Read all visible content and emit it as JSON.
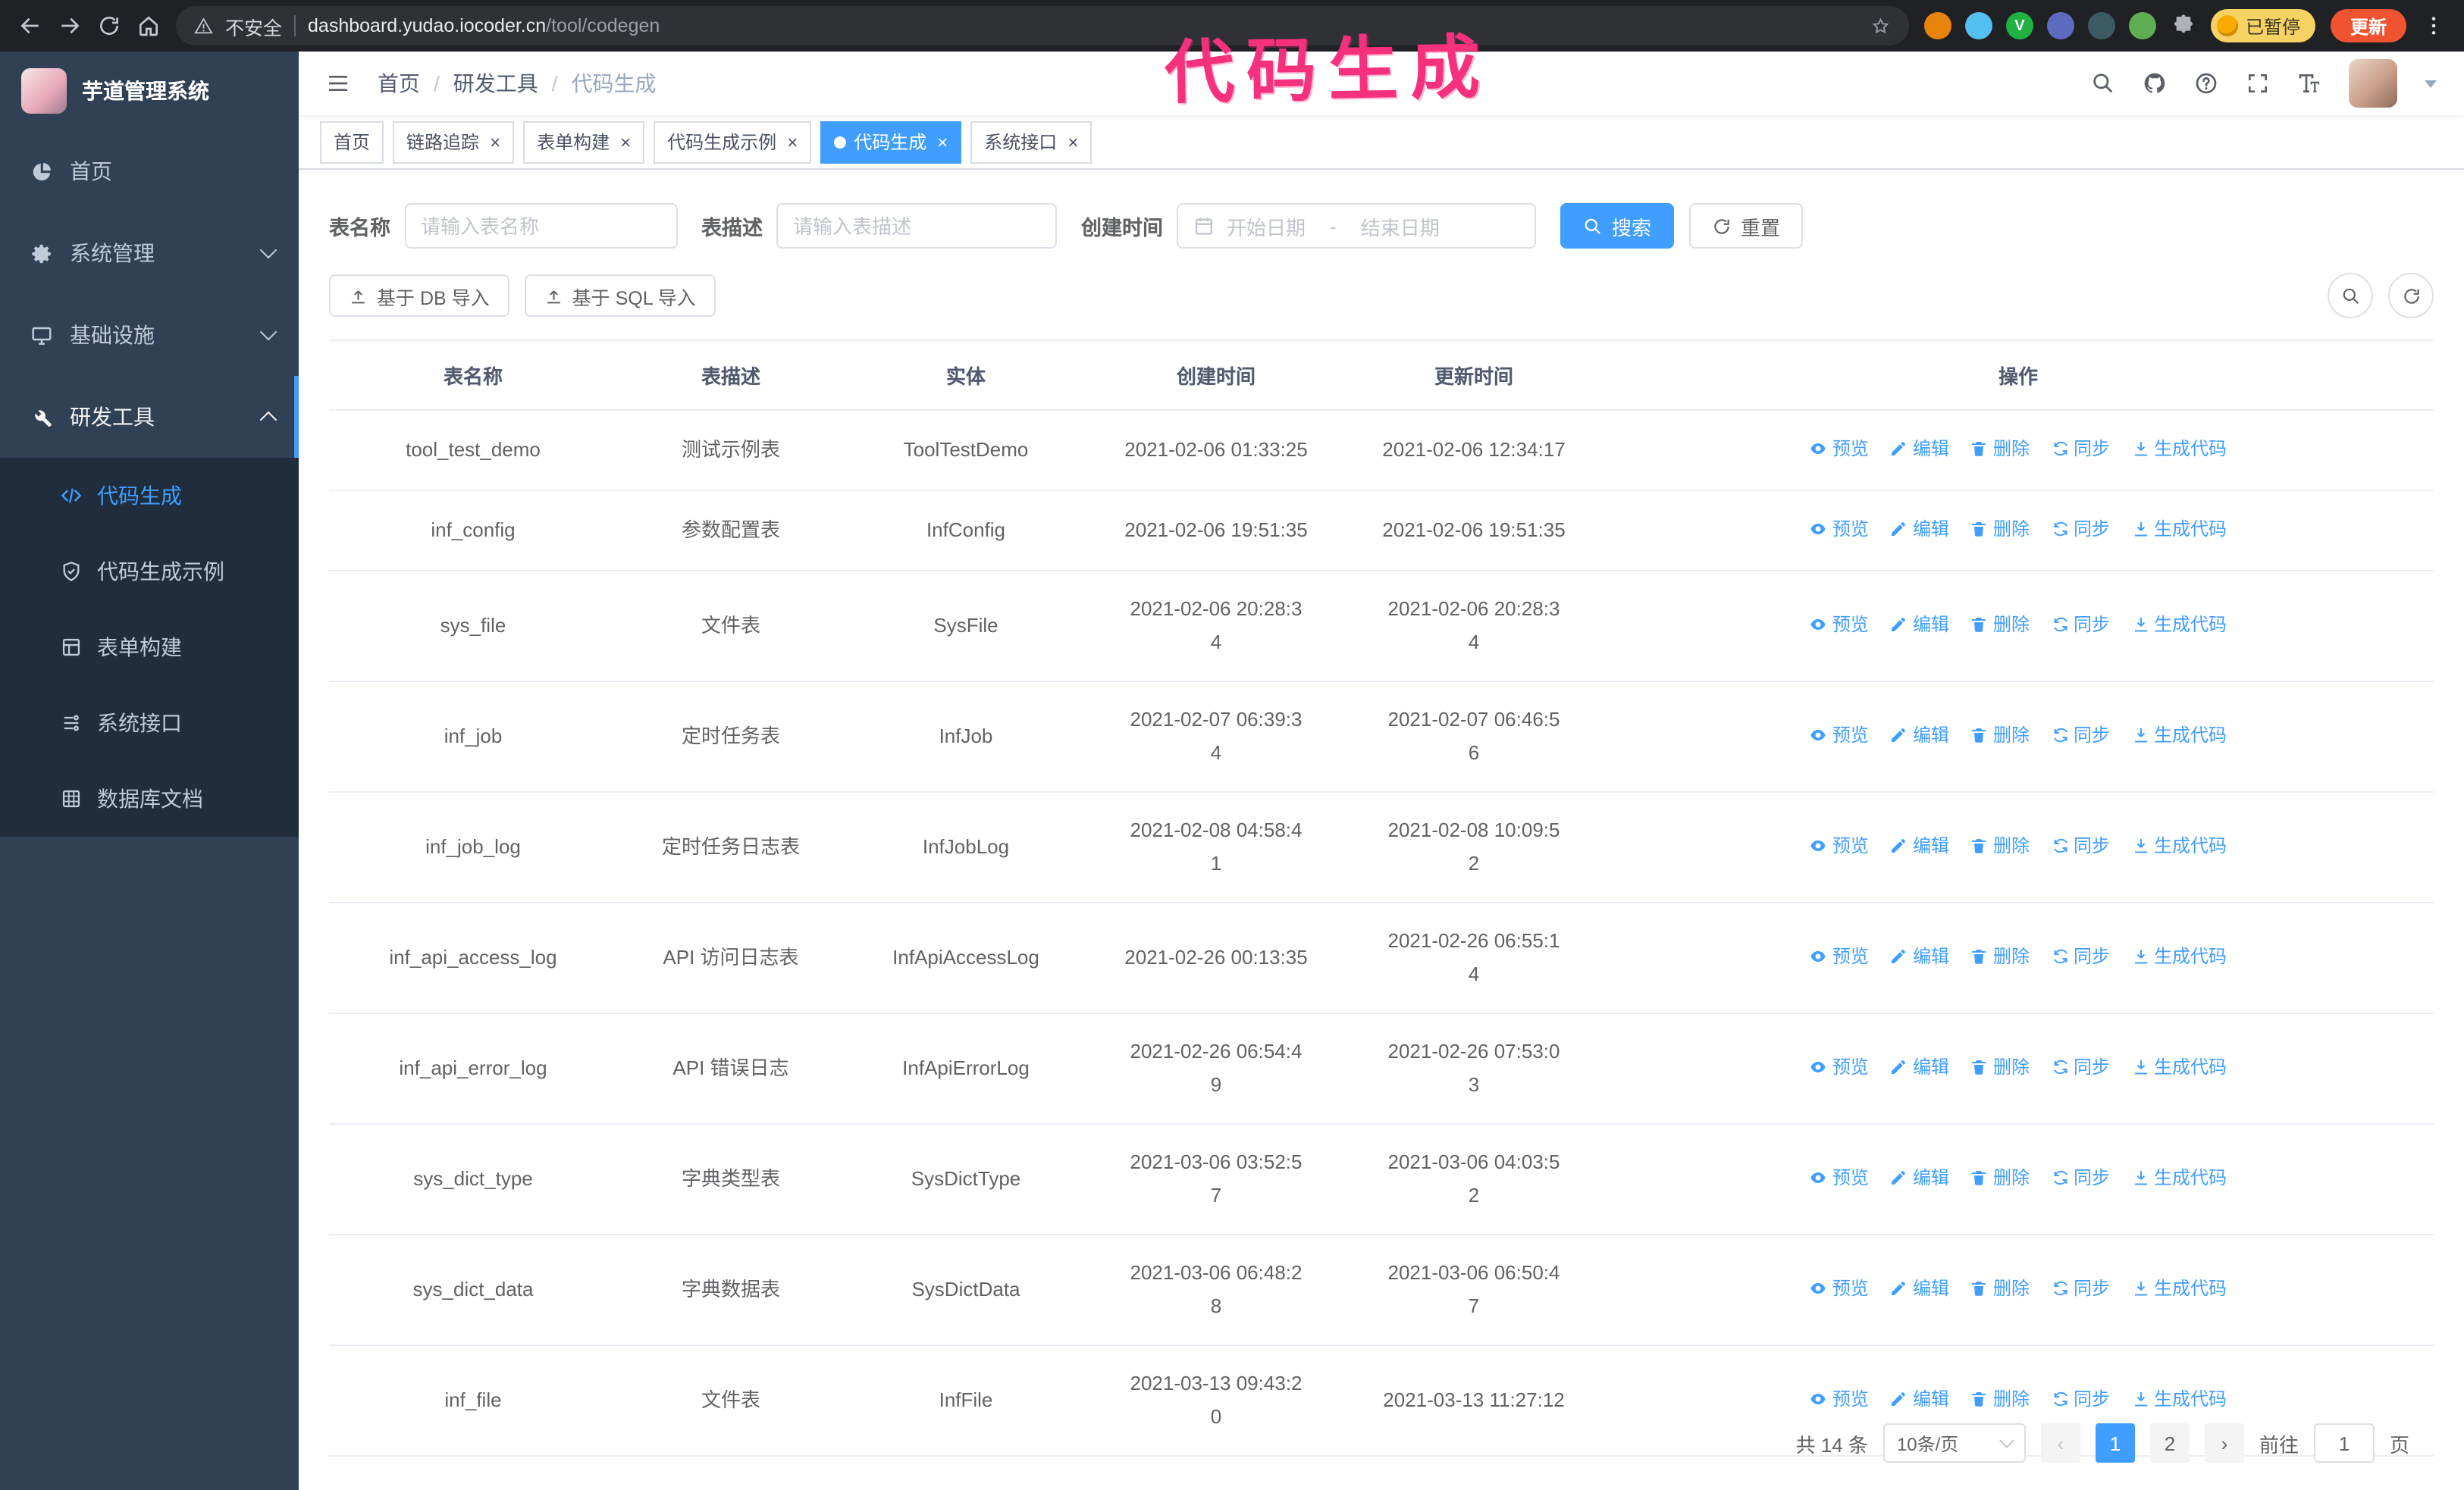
{
  "theme": {
    "accent": "#409eff",
    "sidebar_bg": "#304156",
    "submenu_bg": "#1f2d3d",
    "annotation_color": "#f5307d"
  },
  "annotation": {
    "text": "代码生成"
  },
  "browser": {
    "security_label": "不安全",
    "url_host": "dashboard.yudao.iocoder.cn",
    "url_path": "/tool/codegen",
    "extensions": [
      {
        "name": "orange-extension-icon",
        "color": "#e8830c"
      },
      {
        "name": "blue-extension-icon",
        "color": "#54c0f0"
      },
      {
        "name": "green-check-extension-icon",
        "color": "#1fb141",
        "glyph": "V"
      },
      {
        "name": "indigo-extension-icon",
        "color": "#5c6bc0"
      },
      {
        "name": "dark-extension-icon",
        "color": "#3c5a64"
      },
      {
        "name": "leaf-extension-icon",
        "color": "#5fae53"
      }
    ],
    "paused_badge": "已暂停",
    "update_button": "更新"
  },
  "sidebar": {
    "logo_title": "芋道管理系统",
    "items": [
      {
        "key": "home",
        "icon": "i-dash",
        "label": "首页"
      },
      {
        "key": "system",
        "icon": "i-gear",
        "label": "系统管理",
        "children_collapsed": true
      },
      {
        "key": "infra",
        "icon": "i-infra",
        "label": "基础设施",
        "children_collapsed": true
      },
      {
        "key": "devtools",
        "icon": "i-tool",
        "label": "研发工具",
        "open": true,
        "children": [
          {
            "key": "codegen",
            "icon": "i-code",
            "label": "代码生成",
            "active": true
          },
          {
            "key": "codegen-example",
            "icon": "i-badge",
            "label": "代码生成示例"
          },
          {
            "key": "form-build",
            "icon": "i-form",
            "label": "表单构建"
          },
          {
            "key": "system-api",
            "icon": "i-api",
            "label": "系统接口"
          },
          {
            "key": "db-doc",
            "icon": "i-db",
            "label": "数据库文档"
          }
        ]
      }
    ]
  },
  "header": {
    "breadcrumb": [
      "首页",
      "研发工具",
      "代码生成"
    ]
  },
  "tabs": [
    {
      "label": "首页",
      "closable": false
    },
    {
      "label": "链路追踪",
      "closable": true
    },
    {
      "label": "表单构建",
      "closable": true
    },
    {
      "label": "代码生成示例",
      "closable": true
    },
    {
      "label": "代码生成",
      "closable": true,
      "active": true
    },
    {
      "label": "系统接口",
      "closable": true
    }
  ],
  "filters": {
    "table_name_label": "表名称",
    "table_name_placeholder": "请输入表名称",
    "table_desc_label": "表描述",
    "table_desc_placeholder": "请输入表描述",
    "create_time_label": "创建时间",
    "start_date_placeholder": "开始日期",
    "range_separator": "-",
    "end_date_placeholder": "结束日期",
    "search_button": "搜索",
    "reset_button": "重置"
  },
  "toolbar": {
    "import_db_button": "基于 DB 导入",
    "import_sql_button": "基于 SQL 导入"
  },
  "table": {
    "columns": [
      "表名称",
      "表描述",
      "实体",
      "创建时间",
      "更新时间",
      "操作"
    ],
    "action_labels": [
      "预览",
      "编辑",
      "删除",
      "同步",
      "生成代码"
    ],
    "rows": [
      {
        "name": "tool_test_demo",
        "description": "测试示例表",
        "entity": "ToolTestDemo",
        "created": "2021-02-06 01:33:25",
        "updated": "2021-02-06 12:34:17"
      },
      {
        "name": "inf_config",
        "description": "参数配置表",
        "entity": "InfConfig",
        "created": "2021-02-06 19:51:35",
        "updated": "2021-02-06 19:51:35"
      },
      {
        "name": "sys_file",
        "description": "文件表",
        "entity": "SysFile",
        "created": "2021-02-06 20:28:3\n4",
        "updated": "2021-02-06 20:28:3\n4"
      },
      {
        "name": "inf_job",
        "description": "定时任务表",
        "entity": "InfJob",
        "created": "2021-02-07 06:39:3\n4",
        "updated": "2021-02-07 06:46:5\n6"
      },
      {
        "name": "inf_job_log",
        "description": "定时任务日志表",
        "entity": "InfJobLog",
        "created": "2021-02-08 04:58:4\n1",
        "updated": "2021-02-08 10:09:5\n2"
      },
      {
        "name": "inf_api_access_log",
        "description": "API 访问日志表",
        "entity": "InfApiAccessLog",
        "created": "2021-02-26 00:13:35",
        "updated": "2021-02-26 06:55:1\n4"
      },
      {
        "name": "inf_api_error_log",
        "description": "API 错误日志",
        "entity": "InfApiErrorLog",
        "created": "2021-02-26 06:54:4\n9",
        "updated": "2021-02-26 07:53:0\n3"
      },
      {
        "name": "sys_dict_type",
        "description": "字典类型表",
        "entity": "SysDictType",
        "created": "2021-03-06 03:52:5\n7",
        "updated": "2021-03-06 04:03:5\n2"
      },
      {
        "name": "sys_dict_data",
        "description": "字典数据表",
        "entity": "SysDictData",
        "created": "2021-03-06 06:48:2\n8",
        "updated": "2021-03-06 06:50:4\n7"
      },
      {
        "name": "inf_file",
        "description": "文件表",
        "entity": "InfFile",
        "created": "2021-03-13 09:43:2\n0",
        "updated": "2021-03-13 11:27:12"
      }
    ]
  },
  "pagination": {
    "total_text": "共 14 条",
    "page_size": "10条/页",
    "pages": [
      "1",
      "2"
    ],
    "active_page": "1",
    "prev": "‹",
    "next": "›",
    "goto_label": "前往",
    "goto_value": "1",
    "goto_suffix": "页"
  }
}
